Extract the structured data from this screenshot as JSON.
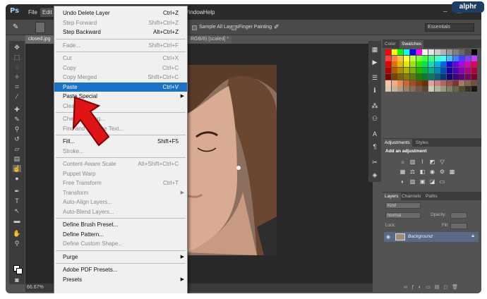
{
  "app": {
    "logo": "Ps"
  },
  "menubar": {
    "items": [
      "File",
      "Edit",
      "Window",
      "Help"
    ]
  },
  "options": {
    "sample_all_layers": "Sample All Layers",
    "finger_painting": "Finger Painting",
    "workspace": "Essentials"
  },
  "document": {
    "tab_name": "closed.jpg",
    "tab_suffix": "RGB/8) [scaled] *",
    "zoom": "66.67%"
  },
  "edit_menu": [
    {
      "label": "Undo Delete Layer",
      "shortcut": "Ctrl+Z",
      "enabled": true
    },
    {
      "label": "Step Forward",
      "shortcut": "Shift+Ctrl+Z",
      "enabled": false
    },
    {
      "label": "Step Backward",
      "shortcut": "Alt+Ctrl+Z",
      "enabled": true
    },
    {
      "separator": true
    },
    {
      "label": "Fade...",
      "shortcut": "Shift+Ctrl+F",
      "enabled": false
    },
    {
      "separator": true
    },
    {
      "label": "Cut",
      "shortcut": "Ctrl+X",
      "enabled": false
    },
    {
      "label": "Copy",
      "shortcut": "Ctrl+C",
      "enabled": false
    },
    {
      "label": "Copy Merged",
      "shortcut": "Shift+Ctrl+C",
      "enabled": false
    },
    {
      "label": "Paste",
      "shortcut": "Ctrl+V",
      "enabled": true,
      "highlighted": true
    },
    {
      "label": "Paste Special",
      "shortcut": "",
      "enabled": true,
      "submenu": true
    },
    {
      "label": "Clear",
      "shortcut": "",
      "enabled": false
    },
    {
      "separator": true
    },
    {
      "label": "Check Spelling...",
      "shortcut": "",
      "enabled": false
    },
    {
      "label": "Find and Replace Text...",
      "shortcut": "",
      "enabled": false
    },
    {
      "separator": true
    },
    {
      "label": "Fill...",
      "shortcut": "Shift+F5",
      "enabled": true
    },
    {
      "label": "Stroke...",
      "shortcut": "",
      "enabled": false
    },
    {
      "separator": true
    },
    {
      "label": "Content-Aware Scale",
      "shortcut": "Alt+Shift+Ctrl+C",
      "enabled": false
    },
    {
      "label": "Puppet Warp",
      "shortcut": "",
      "enabled": false
    },
    {
      "label": "Free Transform",
      "shortcut": "Ctrl+T",
      "enabled": false
    },
    {
      "label": "Transform",
      "shortcut": "",
      "enabled": false,
      "submenu": true
    },
    {
      "label": "Auto-Align Layers...",
      "shortcut": "",
      "enabled": false
    },
    {
      "label": "Auto-Blend Layers...",
      "shortcut": "",
      "enabled": false
    },
    {
      "separator": true
    },
    {
      "label": "Define Brush Preset...",
      "shortcut": "",
      "enabled": true
    },
    {
      "label": "Define Pattern...",
      "shortcut": "",
      "enabled": true
    },
    {
      "label": "Define Custom Shape...",
      "shortcut": "",
      "enabled": false
    },
    {
      "separator": true
    },
    {
      "label": "Purge",
      "shortcut": "",
      "enabled": true,
      "submenu": true
    },
    {
      "separator": true
    },
    {
      "label": "Adobe PDF Presets...",
      "shortcut": "",
      "enabled": true
    },
    {
      "label": "Presets",
      "shortcut": "",
      "enabled": true,
      "submenu": true
    }
  ],
  "panels": {
    "color_tab": "Color",
    "swatches_tab": "Swatches",
    "adjustments_tab": "Adjustments",
    "styles_tab": "Styles",
    "add_adjustment": "Add an adjustment",
    "layers_tab": "Layers",
    "channels_tab": "Channels",
    "paths_tab": "Paths",
    "kind": "Kind",
    "blend_mode": "Normal",
    "opacity_label": "Opacity:",
    "lock_label": "Lock:",
    "fill_label": "Fill:",
    "layer_name": "Background"
  },
  "watermark": "alphr"
}
